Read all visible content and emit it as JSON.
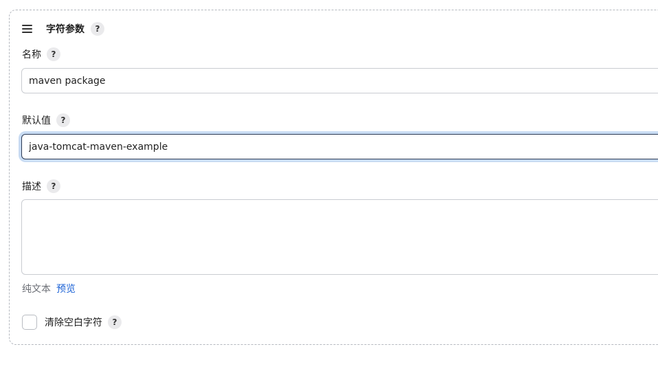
{
  "section": {
    "title": "字符参数",
    "help": "?"
  },
  "fields": {
    "name": {
      "label": "名称",
      "help": "?",
      "value": "maven package"
    },
    "default_value": {
      "label": "默认值",
      "help": "?",
      "value": "java-tomcat-maven-example"
    },
    "description": {
      "label": "描述",
      "help": "?",
      "value": ""
    }
  },
  "format": {
    "label": "纯文本",
    "preview_link": "预览"
  },
  "trim_option": {
    "label": "清除空白字符",
    "help": "?",
    "checked": false
  },
  "colors": {
    "link": "#1d63d6",
    "focus_border": "#2b3a55",
    "focus_ring": "#c9dcf3",
    "help_bg": "#eaeaec"
  },
  "icons": {
    "drag": "drag-handle-icon",
    "help": "help-icon"
  }
}
